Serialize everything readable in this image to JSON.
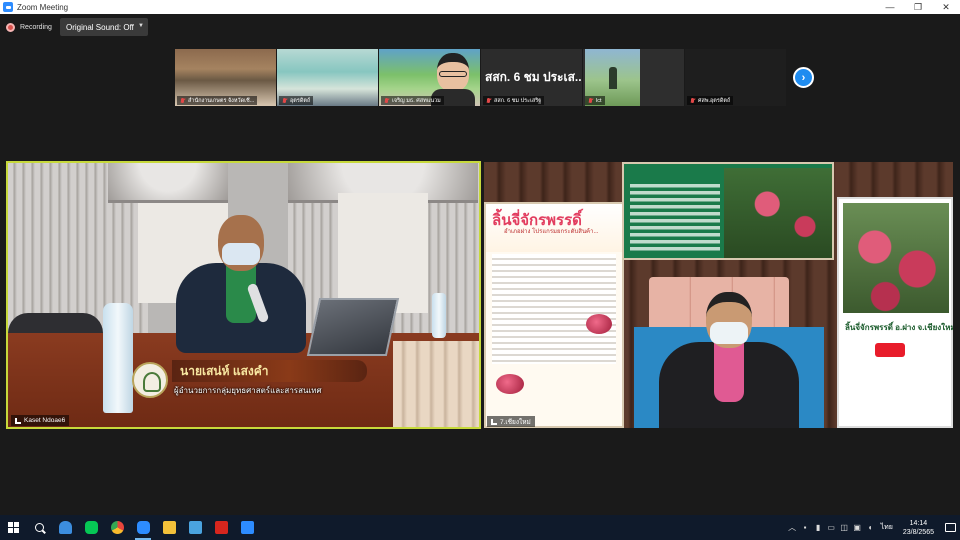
{
  "window": {
    "title": "Zoom Meeting",
    "minimize": "—",
    "maximize": "❐",
    "close": "✕"
  },
  "toolbar": {
    "recording_label": "Recording",
    "sound_label": "Original Sound: Off"
  },
  "thumbnails": [
    {
      "name": "สำนักงานเกษตร จังหวัดเชี..."
    },
    {
      "name": "อุตรดิตถ์"
    },
    {
      "name": "เจริญ มธ. ศสทแนวม"
    },
    {
      "name": "สสก. 6 ชม ประเสริฐ",
      "big_text": "สสก. 6 ชม ประเส..."
    },
    {
      "name": "lct"
    },
    {
      "name": "ศสพ.อุตรดิตถ์"
    }
  ],
  "tiles": {
    "left": {
      "name": "Kaset Ndoae6",
      "nameplate_name": "นายเสน่ห์ แสงคำ",
      "nameplate_title": "ผู้อำนวยการกลุ่มยุทธศาสตร์และสารสนเทศ"
    },
    "right": {
      "name": "7.เชียงใหม่",
      "banner_title": "ลิ้นจี่จักรพรรดิ์",
      "banner_subtitle": "อำเภอฝาง โปรแกรมยกระดับสินค้า...",
      "banner_right_text": "ลิ้นจี่จักรพรรดิ์ อ.ฝาง จ.เชียงใหม่"
    }
  },
  "taskbar": {
    "apps": [
      {
        "icon": "windows-start-icon"
      },
      {
        "icon": "search-icon"
      },
      {
        "icon": "onedrive-icon",
        "color": "#3c8dde"
      },
      {
        "icon": "line-icon",
        "color": "#06c755"
      },
      {
        "icon": "chrome-icon",
        "color": "#e8453c"
      },
      {
        "icon": "zoom-icon",
        "color": "#2d8cff",
        "active": true
      },
      {
        "icon": "file-explorer-icon",
        "color": "#f3c13a"
      },
      {
        "icon": "photos-icon",
        "color": "#4aa3df"
      },
      {
        "icon": "acrobat-icon",
        "color": "#d7261e"
      },
      {
        "icon": "app-icon",
        "color": "#2d8cff"
      }
    ],
    "language": "ไทย",
    "time": "14:14",
    "date": "23/8/2565"
  }
}
